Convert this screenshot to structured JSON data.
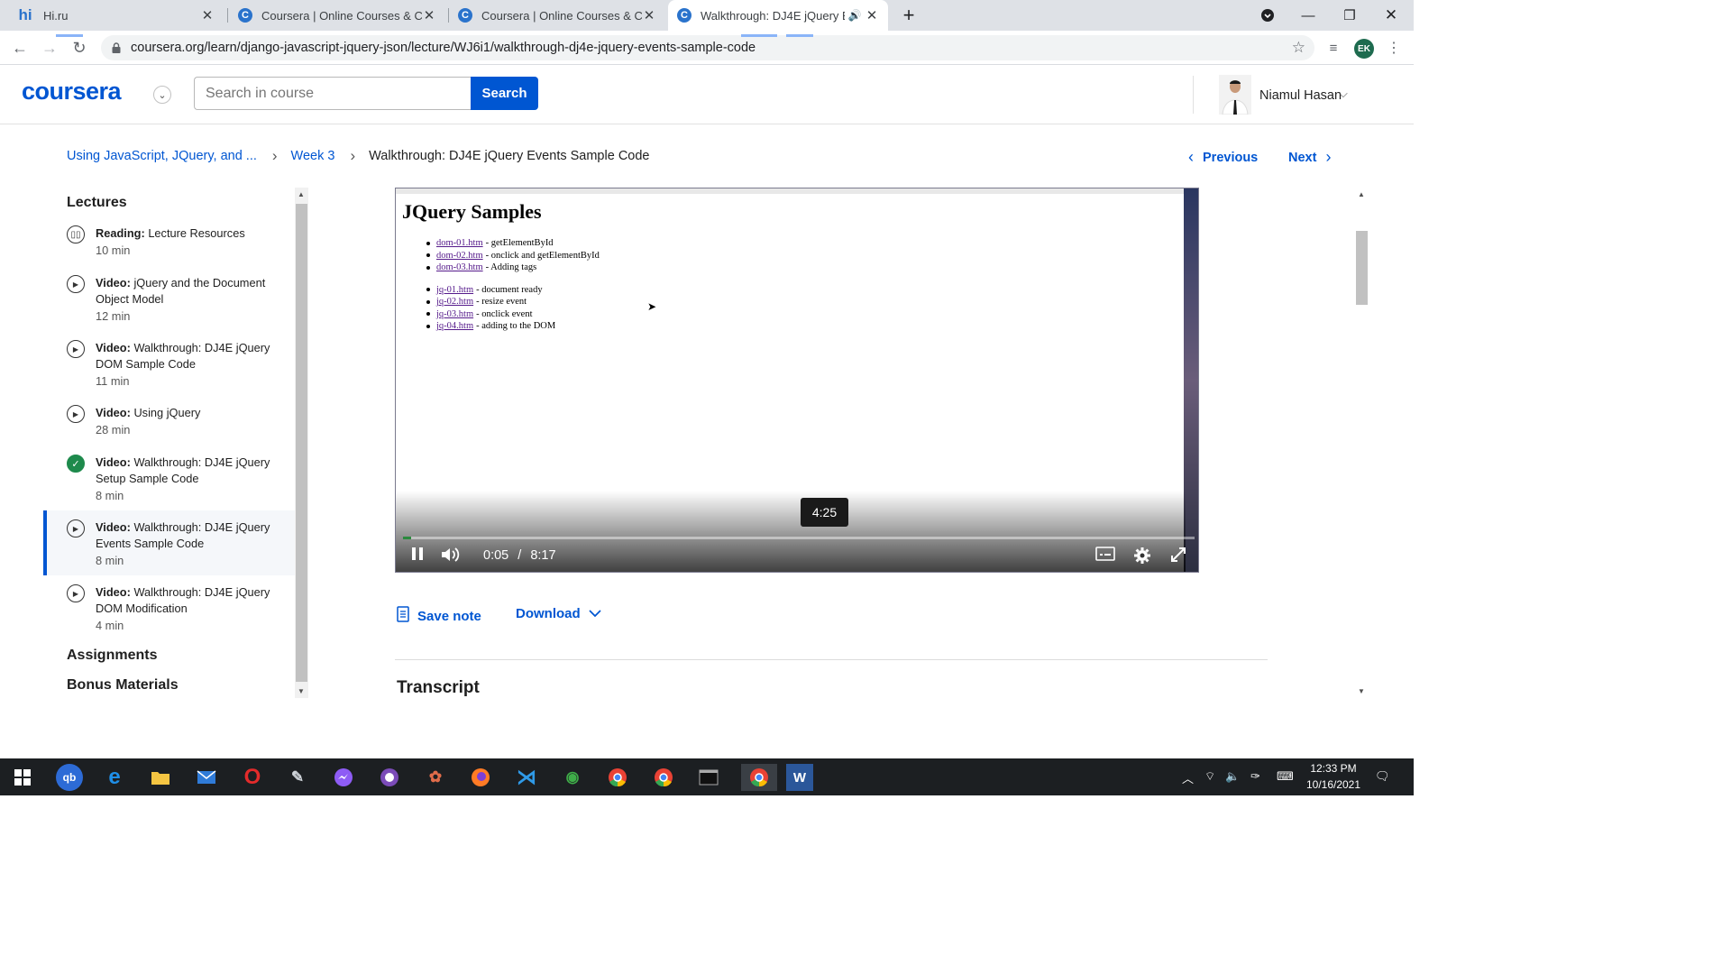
{
  "browser": {
    "tabs": [
      {
        "title": "Hi.ru",
        "favicon": "hi"
      },
      {
        "title": "Coursera | Online Courses & Cre",
        "favicon": "C"
      },
      {
        "title": "Coursera | Online Courses & Cre",
        "favicon": "C"
      },
      {
        "title": "Walkthrough: DJ4E jQuery E",
        "favicon": "C",
        "active": true
      }
    ],
    "url": "coursera.org/learn/django-javascript-jquery-json/lecture/WJ6i1/walkthrough-dj4e-jquery-events-sample-code",
    "profile_initials": "EK"
  },
  "header": {
    "logo": "coursera",
    "search_placeholder": "Search in course",
    "search_button": "Search",
    "user_name": "Niamul Hasan"
  },
  "breadcrumb": {
    "course": "Using JavaScript, JQuery, and ...",
    "week": "Week 3",
    "current": "Walkthrough: DJ4E jQuery Events Sample Code"
  },
  "nav": {
    "previous": "Previous",
    "next": "Next"
  },
  "sidebar": {
    "title": "Lectures",
    "items": [
      {
        "type": "Reading:",
        "title": "Lecture Resources",
        "duration": "10 min",
        "icon": "book-icon"
      },
      {
        "type": "Video:",
        "title": "jQuery and the Document Object Model",
        "duration": "12 min",
        "icon": "play-icon"
      },
      {
        "type": "Video:",
        "title": "Walkthrough: DJ4E jQuery DOM Sample Code",
        "duration": "11 min",
        "icon": "play-icon"
      },
      {
        "type": "Video:",
        "title": "Using jQuery",
        "duration": "28 min",
        "icon": "play-icon"
      },
      {
        "type": "Video:",
        "title": "Walkthrough: DJ4E jQuery Setup Sample Code",
        "duration": "8 min",
        "icon": "check-icon"
      },
      {
        "type": "Video:",
        "title": "Walkthrough: DJ4E jQuery Events Sample Code",
        "duration": "8 min",
        "icon": "play-icon",
        "active": true
      },
      {
        "type": "Video:",
        "title": "Walkthrough: DJ4E jQuery DOM Modification",
        "duration": "4 min",
        "icon": "play-icon"
      }
    ],
    "sections": [
      "Assignments",
      "Bonus Materials"
    ]
  },
  "video": {
    "heading": "JQuery Samples",
    "list_group_1": [
      {
        "link": "dom-01.htm",
        "desc": "- getElementById"
      },
      {
        "link": "dom-02.htm",
        "desc": "- onclick and getElementById"
      },
      {
        "link": "dom-03.htm",
        "desc": "- Adding tags"
      }
    ],
    "list_group_2": [
      {
        "link": "jq-01.htm",
        "desc": "- document ready"
      },
      {
        "link": "jq-02.htm",
        "desc": "- resize event"
      },
      {
        "link": "jq-03.htm",
        "desc": "- onclick event"
      },
      {
        "link": "jq-04.htm",
        "desc": "- adding to the DOM"
      }
    ],
    "hover_time": "4:25",
    "current_time": "0:05",
    "time_separator": "/",
    "total_time": "8:17",
    "progress_fraction": 0.01
  },
  "actions": {
    "save_note": "Save note",
    "download": "Download"
  },
  "transcript_title": "Transcript",
  "taskbar": {
    "time": "12:33 PM",
    "date": "10/16/2021"
  }
}
